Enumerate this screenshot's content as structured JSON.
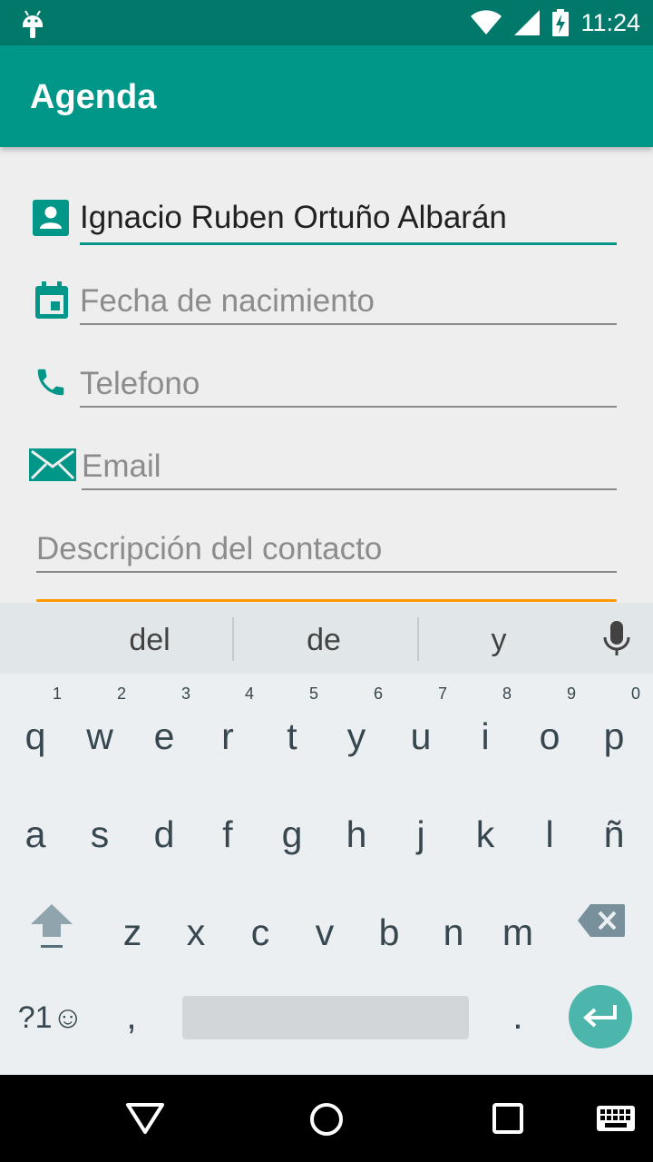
{
  "status_bar": {
    "time": "11:24"
  },
  "app_bar": {
    "title": "Agenda"
  },
  "form": {
    "name": {
      "value": "Ignacio Ruben Ortuño Albarán"
    },
    "birthdate": {
      "placeholder": "Fecha de nacimiento"
    },
    "phone": {
      "placeholder": "Telefono"
    },
    "email": {
      "placeholder": "Email"
    },
    "description": {
      "placeholder": "Descripción del contacto"
    }
  },
  "keyboard": {
    "suggestions": [
      "del",
      "de",
      "y"
    ],
    "row1": [
      {
        "k": "q",
        "n": "1"
      },
      {
        "k": "w",
        "n": "2"
      },
      {
        "k": "e",
        "n": "3"
      },
      {
        "k": "r",
        "n": "4"
      },
      {
        "k": "t",
        "n": "5"
      },
      {
        "k": "y",
        "n": "6"
      },
      {
        "k": "u",
        "n": "7"
      },
      {
        "k": "i",
        "n": "8"
      },
      {
        "k": "o",
        "n": "9"
      },
      {
        "k": "p",
        "n": "0"
      }
    ],
    "row2": [
      "a",
      "s",
      "d",
      "f",
      "g",
      "h",
      "j",
      "k",
      "l",
      "ñ"
    ],
    "row3": [
      "z",
      "x",
      "c",
      "v",
      "b",
      "n",
      "m"
    ],
    "symbols_label": "?1☺",
    "comma": ",",
    "period": "."
  },
  "colors": {
    "status_bar": "#00796b",
    "primary": "#009688",
    "accent": "#ff9800",
    "enter_key": "#4db6ac"
  },
  "icons": {
    "status": [
      "android-icon",
      "wifi-icon",
      "signal-icon",
      "battery-charging-icon"
    ],
    "fields": [
      "contact-icon",
      "calendar-icon",
      "phone-icon",
      "email-icon"
    ],
    "keyboard": [
      "mic-icon",
      "shift-icon",
      "backspace-icon",
      "enter-icon"
    ],
    "nav": [
      "back-icon",
      "home-icon",
      "recents-icon",
      "keyboard-switch-icon"
    ]
  }
}
